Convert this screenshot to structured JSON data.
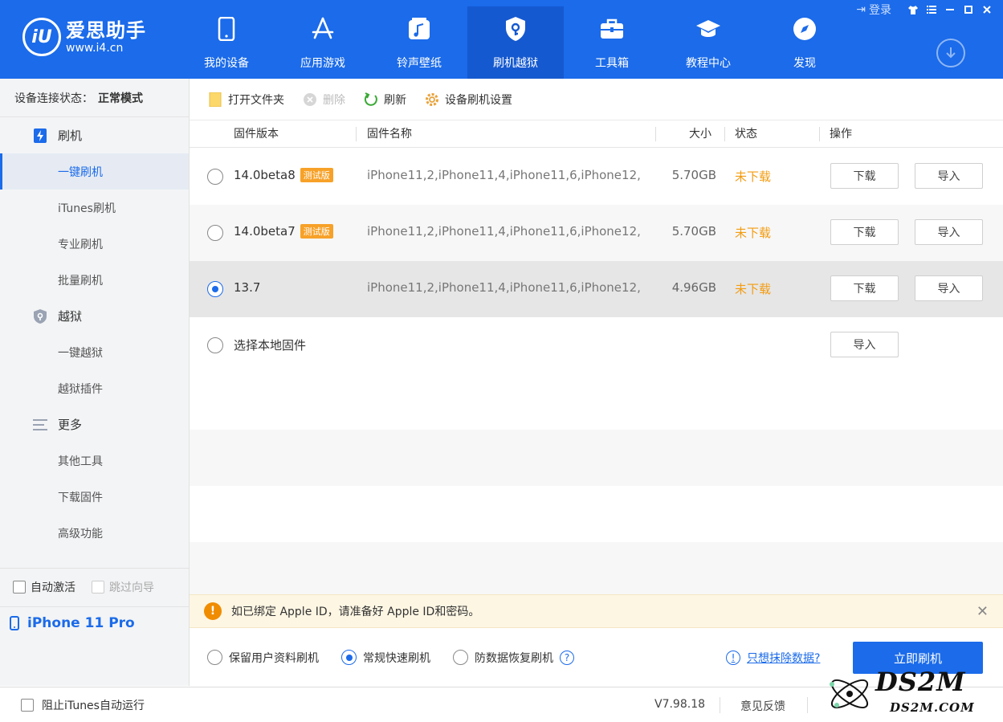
{
  "app": {
    "logo_mark": "iU",
    "name": "爱思助手",
    "url": "www.i4.cn",
    "login_label": "登录"
  },
  "nav": [
    {
      "label": "我的设备",
      "icon": "phone-icon"
    },
    {
      "label": "应用游戏",
      "icon": "app-store-icon"
    },
    {
      "label": "铃声壁纸",
      "icon": "music-icon"
    },
    {
      "label": "刷机越狱",
      "icon": "shield-key-icon",
      "active": true
    },
    {
      "label": "工具箱",
      "icon": "toolbox-icon"
    },
    {
      "label": "教程中心",
      "icon": "graduation-cap-icon"
    },
    {
      "label": "发现",
      "icon": "compass-icon"
    }
  ],
  "sidebar": {
    "status_label": "设备连接状态：",
    "status_value": "正常模式",
    "groups": [
      {
        "label": "刷机",
        "items": [
          "一键刷机",
          "iTunes刷机",
          "专业刷机",
          "批量刷机"
        ]
      },
      {
        "label": "越狱",
        "items": [
          "一键越狱",
          "越狱插件"
        ]
      },
      {
        "label": "更多",
        "items": [
          "其他工具",
          "下载固件",
          "高级功能"
        ]
      }
    ],
    "auto_activate": "自动激活",
    "skip_guide": "跳过向导",
    "device_name": "iPhone 11 Pro"
  },
  "toolbar": {
    "open_folder": "打开文件夹",
    "delete": "删除",
    "refresh": "刷新",
    "settings": "设备刷机设置"
  },
  "table": {
    "headers": {
      "version": "固件版本",
      "name": "固件名称",
      "size": "大小",
      "status": "状态",
      "action": "操作"
    },
    "rows": [
      {
        "version": "14.0beta8",
        "badge": "测试版",
        "name": "iPhone11,2,iPhone11,4,iPhone11,6,iPhone12,...",
        "size": "5.70GB",
        "status": "未下载",
        "download": "下载",
        "import": "导入"
      },
      {
        "version": "14.0beta7",
        "badge": "测试版",
        "name": "iPhone11,2,iPhone11,4,iPhone11,6,iPhone12,...",
        "size": "5.70GB",
        "status": "未下载",
        "download": "下载",
        "import": "导入"
      },
      {
        "version": "13.7",
        "badge": "",
        "name": "iPhone11,2,iPhone11,4,iPhone11,6,iPhone12,...",
        "size": "4.96GB",
        "status": "未下载",
        "download": "下载",
        "import": "导入",
        "selected": true
      }
    ],
    "local": {
      "label": "选择本地固件",
      "import": "导入"
    }
  },
  "notice": {
    "text": "如已绑定 Apple ID，请准备好 Apple ID和密码。"
  },
  "modes": {
    "keep_data": "保留用户资料刷机",
    "quick": "常规快速刷机",
    "anti_recovery": "防数据恢复刷机",
    "erase_link": "只想抹除数据?",
    "flash_now": "立即刷机"
  },
  "statusbar": {
    "block_itunes": "阻止iTunes自动运行",
    "version": "V7.98.18",
    "feedback": "意见反馈"
  },
  "watermark": {
    "title": "DS2M",
    "sub": "DS2M.COM"
  },
  "colors": {
    "brand": "#1b6bea",
    "warning": "#f39c12",
    "badge": "#f7a128"
  }
}
